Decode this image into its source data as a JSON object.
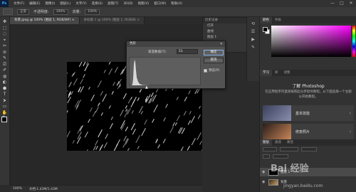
{
  "menubar": {
    "logo": "Ps",
    "items": [
      "文件(F)",
      "编辑(E)",
      "图像(I)",
      "图层(L)",
      "文字(Y)",
      "选择(S)",
      "滤镜(T)",
      "3D(D)",
      "视图(V)",
      "窗口(W)",
      "帮助(H)"
    ],
    "minimize": "—",
    "maximize": "□",
    "close": "✕"
  },
  "options": {
    "mode_label": "正常",
    "opacity_label": "不透明度:",
    "opacity_value": "100%",
    "flow_label": "流量:",
    "flow_value": "100%"
  },
  "tabs": [
    {
      "label": "背景.jpeg @ 100% (图层 1, RGB/8#) ×",
      "active": true
    },
    {
      "label": "未标题-1 @ 100% (图层 1, RGB/8) ×",
      "active": false
    }
  ],
  "toolbar": {
    "tools": [
      "✥",
      "⬚",
      "◌",
      "⌖",
      "✂",
      "⊘",
      "✎",
      "⎚",
      "✐",
      "◍",
      "◐",
      "⬢",
      "T",
      "⮞",
      "▭",
      "✋",
      "🔍"
    ]
  },
  "statusbar": {
    "zoom": "100%",
    "doc_info": "文档:1.43M/1.43M"
  },
  "midpanel": {
    "header": "历史记录",
    "rows": [
      "打开",
      "曲线",
      "图层 1"
    ]
  },
  "rightpanel": {
    "color_tabs": [
      "颜色",
      "色板"
    ],
    "learn_tabs": [
      "学习",
      "库",
      "调整"
    ],
    "learn_title": "了解 Photoshop",
    "learn_desc": "在应用程序内直接按照此分步指导教程。从下面选择一个主题以开始教程。",
    "cards": [
      {
        "label": "基本技能",
        "thumb": "#556"
      },
      {
        "label": "修复照片",
        "thumb": "#6a4a3a"
      }
    ],
    "layers_tabs": [
      "图层",
      "通道",
      "路径"
    ],
    "layers": [
      {
        "name": "图层 1",
        "thumb": "#000000",
        "selected": true
      },
      {
        "name": "背景",
        "thumb": "#b08a5a",
        "selected": false
      }
    ]
  },
  "dialog": {
    "title": "色阶",
    "close": "✕",
    "field_label": "渐变数值(T):",
    "field_value": "51",
    "ok": "确定",
    "cancel": "取消",
    "preview": "预览(P)",
    "preview_checked": "✓",
    "slider": "▲"
  },
  "watermark": {
    "text": "Bai 经验",
    "url": "jingyan.baidu.com"
  },
  "colors": {
    "accent": "#31a8ff",
    "panel_bg": "#323232",
    "canvas_bg": "#282828"
  }
}
